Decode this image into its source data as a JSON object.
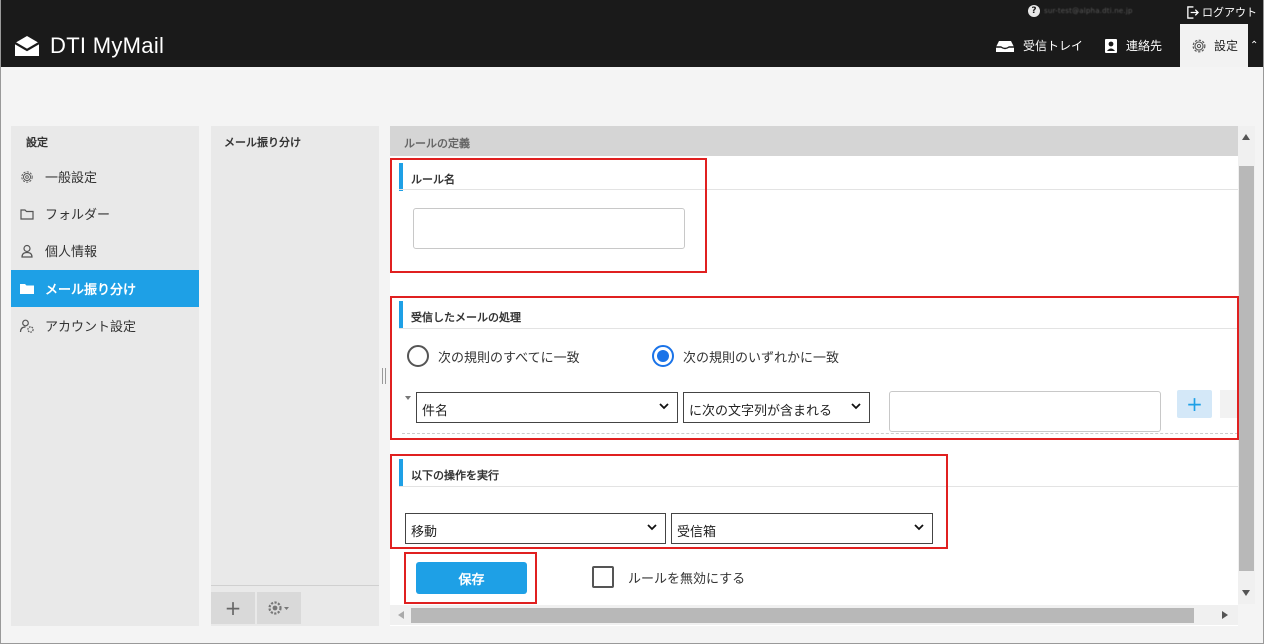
{
  "topbar": {
    "user_email": "sur-test@alpha.dti.ne.jp",
    "logout_label": "ログアウト"
  },
  "header": {
    "brand": "DTI MyMail",
    "nav": {
      "inbox": "受信トレイ",
      "contacts": "連絡先",
      "settings": "設定"
    }
  },
  "sidebar": {
    "title": "設定",
    "items": [
      {
        "label": "一般設定",
        "icon": "gear-icon"
      },
      {
        "label": "フォルダー",
        "icon": "folder-icon"
      },
      {
        "label": "個人情報",
        "icon": "person-icon"
      },
      {
        "label": "メール振り分け",
        "icon": "folder-icon",
        "active": true
      },
      {
        "label": "アカウント設定",
        "icon": "account-settings-icon"
      }
    ]
  },
  "middle": {
    "title": "メール振り分け"
  },
  "panel": {
    "header": "ルールの定義",
    "rule_name": {
      "title": "ルール名",
      "value": ""
    },
    "incoming": {
      "title": "受信したメールの処理",
      "match_all_label": "次の規則のすべてに一致",
      "match_any_label": "次の規則のいずれかに一致",
      "selected": "match_any",
      "rule": {
        "field": "件名",
        "operator": "に次の文字列が含まれる",
        "value": ""
      }
    },
    "actions": {
      "title": "以下の操作を実行",
      "action": "移動",
      "target": "受信箱"
    },
    "save_label": "保存",
    "disable_label": "ルールを無効にする",
    "disable_checked": false
  },
  "colors": {
    "accent": "#1ea0e6",
    "header_bg": "#1a1a1a",
    "annotation": "#e02020"
  }
}
